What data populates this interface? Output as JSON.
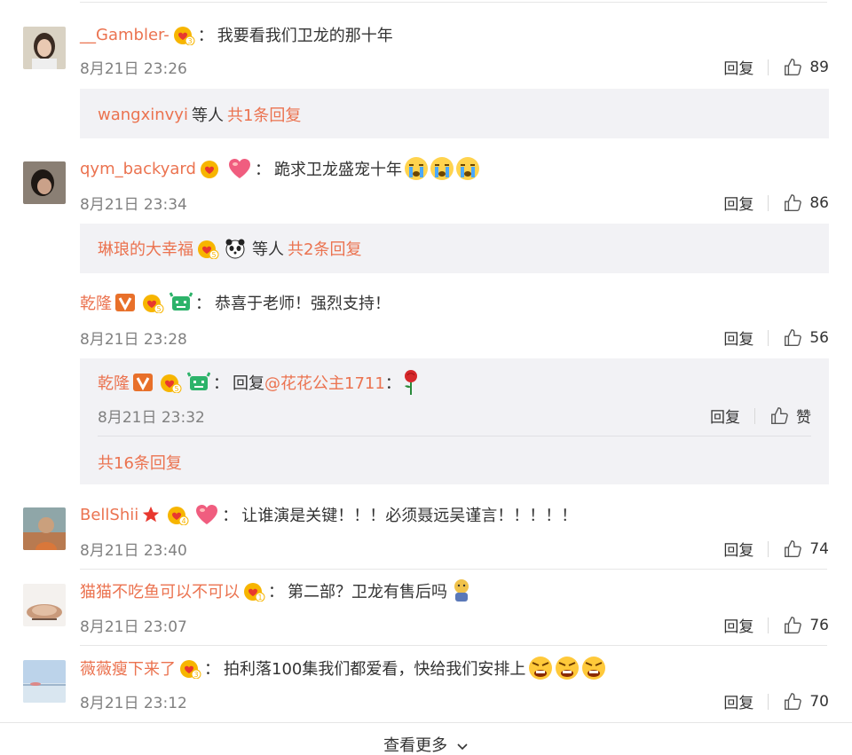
{
  "comments": [
    {
      "user": "__Gambler-",
      "text": "我要看我们卫龙的那十年",
      "time": "8月21日 23:26",
      "reply_label": "回复",
      "likes": "89",
      "sub": {
        "users": "wangxinvyi",
        "mid": "等人",
        "total": "共1条回复"
      }
    },
    {
      "user": "qym_backyard",
      "text": "跪求卫龙盛宠十年",
      "time": "8月21日 23:34",
      "reply_label": "回复",
      "likes": "86",
      "sub": {
        "users": "琳琅的大幸福",
        "mid": "等人",
        "total": "共2条回复"
      }
    },
    {
      "user": "乾隆",
      "text": "恭喜于老师！强烈支持！",
      "time": "8月21日 23:28",
      "reply_label": "回复",
      "likes": "56",
      "reply": {
        "user": "乾隆",
        "prefix": "回复",
        "mention": "@花花公主1711",
        "time": "8月21日 23:32",
        "reply_label": "回复",
        "like_label": "赞",
        "total": "共16条回复"
      }
    },
    {
      "user": "BellShii",
      "text": "让谁演是关键！！！必须聂远吴谨言！！！！！",
      "time": "8月21日 23:40",
      "reply_label": "回复",
      "likes": "74"
    },
    {
      "user": "猫猫不吃鱼可以不可以",
      "text": "第二部？卫龙有售后吗",
      "time": "8月21日 23:07",
      "reply_label": "回复",
      "likes": "76"
    },
    {
      "user": "薇薇瘦下来了",
      "text": "拍利落100集我们都爱看，快给我们安排上",
      "time": "8月21日 23:12",
      "reply_label": "回复",
      "likes": "70"
    }
  ],
  "colon": "：",
  "load_more": "查看更多",
  "colors": {
    "username": "#eb7350",
    "text": "#333333",
    "meta": "#808080",
    "subbox": "#f2f2f5"
  }
}
